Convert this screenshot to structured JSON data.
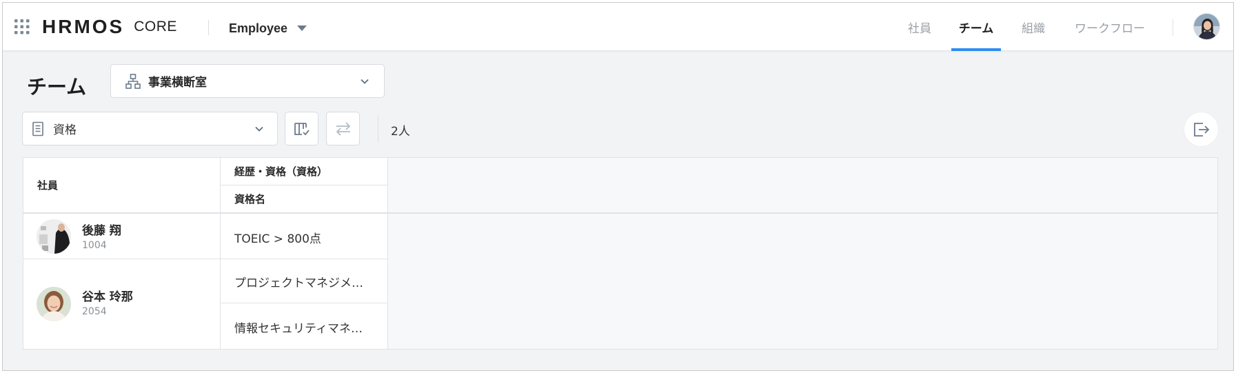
{
  "header": {
    "logo_main": "HRMOS",
    "logo_sub": "CORE",
    "product": "Employee",
    "nav": [
      {
        "label": "社員",
        "active": false
      },
      {
        "label": "チーム",
        "active": true
      },
      {
        "label": "組織",
        "active": false
      },
      {
        "label": "ワークフロー",
        "active": false
      }
    ]
  },
  "page": {
    "title": "チーム",
    "org_select": "事業横断室"
  },
  "toolbar": {
    "view_select": "資格",
    "count": "2人"
  },
  "table": {
    "col_employee": "社員",
    "col_group": "経歴・資格（資格）",
    "col_name": "資格名",
    "rows": [
      {
        "name": "後藤 翔",
        "id": "1004",
        "quals": [
          "TOEIC > 800点"
        ]
      },
      {
        "name": "谷本 玲那",
        "id": "2054",
        "quals": [
          "プロジェクトマネジメ…",
          "情報セキュリティマネ…"
        ]
      }
    ]
  },
  "colors": {
    "accent": "#2d8cf0",
    "background": "#f2f3f5",
    "border": "#d7dbe0"
  }
}
